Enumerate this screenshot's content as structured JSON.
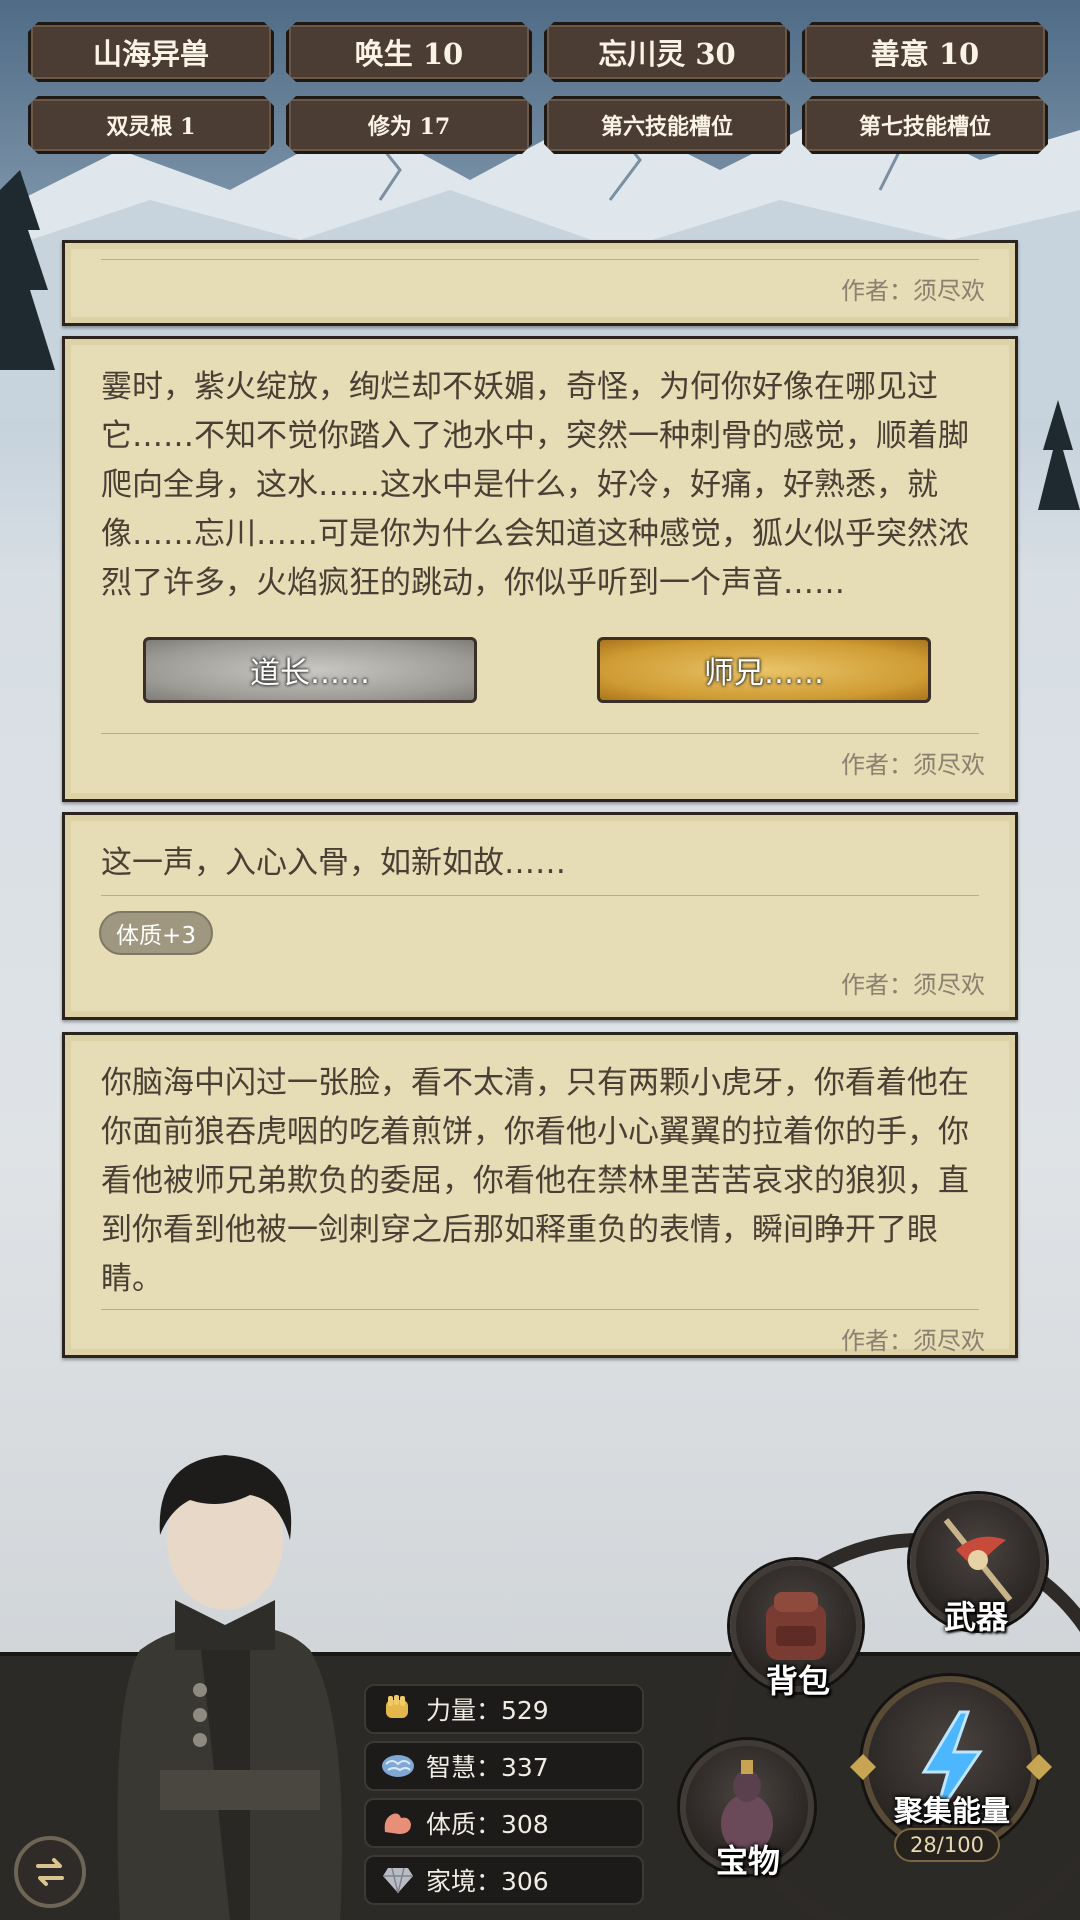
{
  "top_tags": [
    {
      "label": "山海异兽"
    },
    {
      "label": "唤生 10"
    },
    {
      "label": "忘川灵 30"
    },
    {
      "label": "善意 10"
    }
  ],
  "sub_tags": [
    {
      "label": "双灵根 1"
    },
    {
      "label": "修为 17"
    },
    {
      "label": "第六技能槽位"
    },
    {
      "label": "第七技能槽位"
    }
  ],
  "cards": [
    {
      "author": "作者：须尽欢"
    },
    {
      "text": "霎时，紫火绽放，绚烂却不妖媚，奇怪，为何你好像在哪见过它……不知不觉你踏入了池水中，突然一种刺骨的感觉，顺着脚爬向全身，这水……这水中是什么，好冷，好痛，好熟悉，就像……忘川……可是你为什么会知道这种感觉，狐火似乎突然浓烈了许多，火焰疯狂的跳动，你似乎听到一个声音……",
      "choices": [
        "道长……",
        "师兄……"
      ],
      "author": "作者：须尽欢"
    },
    {
      "text": "这一声，入心入骨，如新如故……",
      "badge": "体质+3",
      "author": "作者：须尽欢"
    },
    {
      "text": "你脑海中闪过一张脸，看不太清，只有两颗小虎牙，你看着他在你面前狼吞虎咽的吃着煎饼，你看他小心翼翼的拉着你的手，你看他被师兄弟欺负的委屈，你看他在禁林里苦苦哀求的狼狈，直到你看到他被一剑刺穿之后那如释重负的表情，瞬间睁开了眼睛。",
      "author": "作者：须尽欢"
    }
  ],
  "stats": [
    {
      "icon": "fist-icon",
      "label": "力量：529"
    },
    {
      "icon": "brain-icon",
      "label": "智慧：337"
    },
    {
      "icon": "muscle-icon",
      "label": "体质：308"
    },
    {
      "icon": "diamond-icon",
      "label": "家境：306"
    }
  ],
  "actions": {
    "weapon": "武器",
    "bag": "背包",
    "treasure": "宝物",
    "gather": "聚集能量",
    "gather_progress": "28/100"
  },
  "colors": {
    "card_bg": "#e6dcb5",
    "tag_bg": "#4b3d33",
    "choice_gold": "#cf9b33",
    "choice_grey": "#9d9b96"
  }
}
